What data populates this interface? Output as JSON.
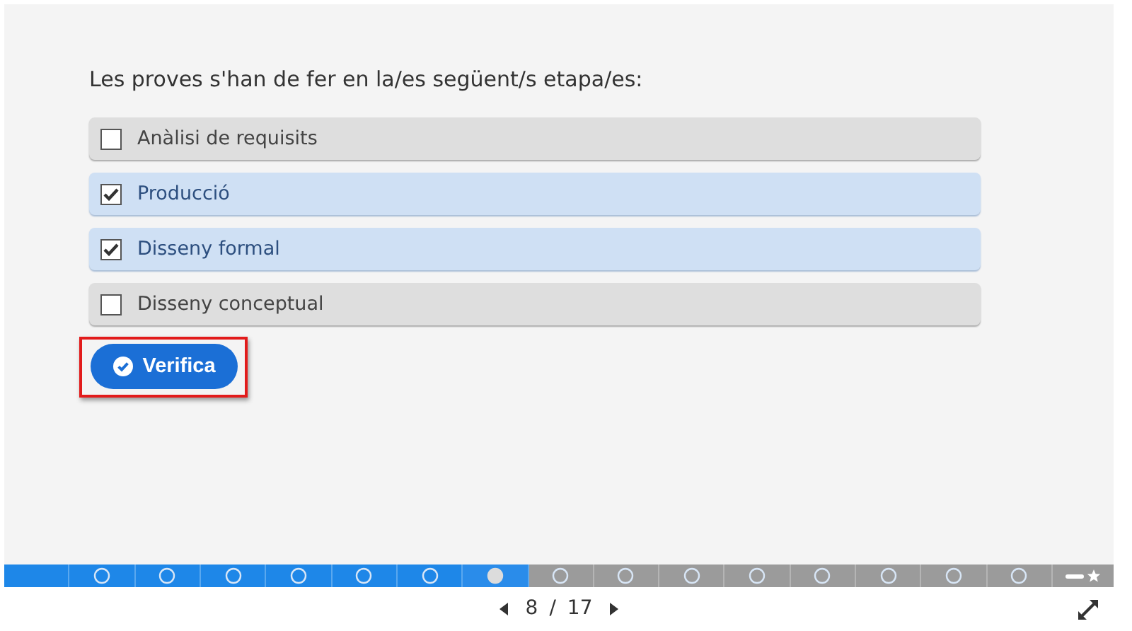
{
  "question": "Les proves s'han de fer en la/es següent/s etapa/es:",
  "options": [
    {
      "label": "Anàlisi de requisits",
      "checked": false
    },
    {
      "label": "Producció",
      "checked": true
    },
    {
      "label": "Disseny formal",
      "checked": true
    },
    {
      "label": "Disseny conceptual",
      "checked": false
    }
  ],
  "verify_button": {
    "label": "Verifica",
    "highlighted": true
  },
  "progress": [
    {
      "kind": "blank",
      "visited": true,
      "current": false
    },
    {
      "kind": "circle",
      "visited": true,
      "current": false
    },
    {
      "kind": "circle",
      "visited": true,
      "current": false
    },
    {
      "kind": "circle",
      "visited": true,
      "current": false
    },
    {
      "kind": "circle",
      "visited": true,
      "current": false
    },
    {
      "kind": "circle",
      "visited": true,
      "current": false
    },
    {
      "kind": "circle",
      "visited": true,
      "current": false
    },
    {
      "kind": "circle",
      "visited": true,
      "current": true
    },
    {
      "kind": "circle",
      "visited": false,
      "current": false
    },
    {
      "kind": "circle",
      "visited": false,
      "current": false
    },
    {
      "kind": "circle",
      "visited": false,
      "current": false
    },
    {
      "kind": "circle",
      "visited": false,
      "current": false
    },
    {
      "kind": "circle",
      "visited": false,
      "current": false
    },
    {
      "kind": "circle",
      "visited": false,
      "current": false
    },
    {
      "kind": "circle",
      "visited": false,
      "current": false
    },
    {
      "kind": "circle",
      "visited": false,
      "current": false
    },
    {
      "kind": "star",
      "visited": false,
      "current": false
    }
  ],
  "pager": {
    "current": "8",
    "separator": "/",
    "total": "17"
  }
}
